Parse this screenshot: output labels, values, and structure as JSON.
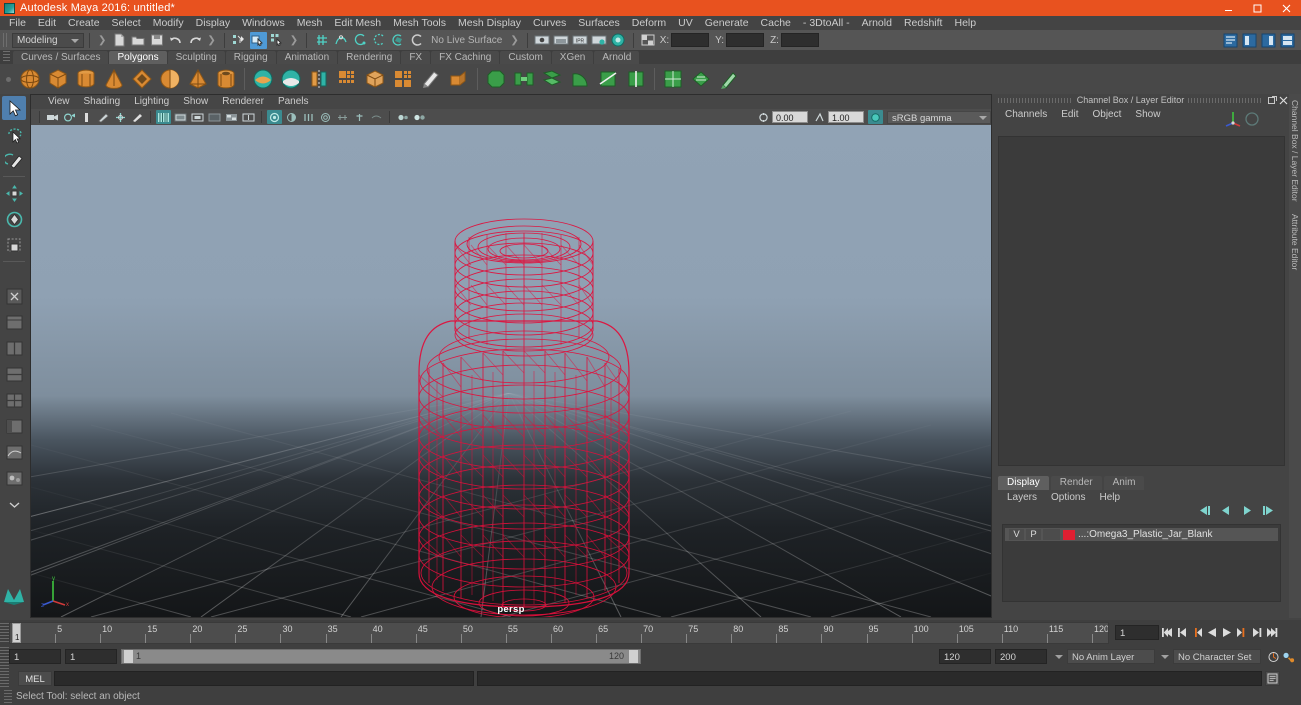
{
  "window": {
    "title": "Autodesk Maya 2016: untitled*",
    "app_icon": "maya-logo-icon",
    "titlebar_color": "#e8521f",
    "controls": {
      "minimize": "minimize-icon",
      "maximize": "maximize-icon",
      "close": "close-icon"
    }
  },
  "menubar": {
    "items": [
      "File",
      "Edit",
      "Create",
      "Select",
      "Modify",
      "Display",
      "Windows",
      "Mesh",
      "Edit Mesh",
      "Mesh Tools",
      "Mesh Display",
      "Curves",
      "Surfaces",
      "Deform",
      "UV",
      "Generate",
      "Cache",
      "- 3DtoAll -",
      "Arnold",
      "Redshift",
      "Help"
    ]
  },
  "statusline": {
    "mode": "Modeling",
    "live_surface": "No Live Surface",
    "coords": {
      "x_label": "X:",
      "x_value": "",
      "y_label": "Y:",
      "y_value": "",
      "z_label": "Z:",
      "z_value": ""
    },
    "file_icons": [
      "new-scene-icon",
      "open-scene-icon",
      "save-scene-icon",
      "undo-icon",
      "redo-icon"
    ],
    "select_mode_icons": [
      "select-by-hierarchy-icon",
      "select-by-object-type-icon",
      "select-by-component-type-icon"
    ],
    "snap_icons": [
      "snap-to-grid-icon",
      "snap-to-curve-icon",
      "snap-to-point-icon",
      "snap-to-projected-center-icon",
      "snap-to-view-plane-icon",
      "make-live-icon"
    ],
    "render_icons": [
      "render-current-frame-icon",
      "ipr-render-icon",
      "render-settings-icon",
      "hypershade-icon",
      "render-view-icon"
    ],
    "editor_icons": [
      "open-attribute-editor-icon",
      "open-tool-settings-icon",
      "open-channel-box-icon"
    ]
  },
  "shelf": {
    "tabs": [
      "Curves / Surfaces",
      "Polygons",
      "Sculpting",
      "Rigging",
      "Animation",
      "Rendering",
      "FX",
      "FX Caching",
      "Custom",
      "XGen",
      "Arnold"
    ],
    "active_tab": "Polygons",
    "icons": [
      "poly-sphere-icon",
      "poly-cube-icon",
      "poly-cylinder-icon",
      "poly-cone-icon",
      "poly-torus-icon",
      "poly-plane-icon",
      "poly-pyramid-icon",
      "poly-pipe-icon",
      "combine-icon",
      "separate-icon",
      "mirror-geometry-icon",
      "smooth-icon",
      "boolean-icon",
      "quadrangulate-icon",
      "edit-mesh-icon",
      "extrude-icon",
      "bevel-icon",
      "bridge-icon",
      "append-polygon-icon",
      "wedge-icon",
      "multi-cut-icon",
      "insert-edge-loop-icon",
      "offset-edge-loop-icon",
      "sculpt-geometry-icon",
      "uv-editor-icon",
      "planar-mapping-icon"
    ]
  },
  "toolbox": {
    "tools": [
      {
        "name": "select-tool-icon",
        "active": true
      },
      {
        "name": "lasso-select-tool-icon",
        "active": false
      },
      {
        "name": "paint-select-tool-icon",
        "active": false
      },
      {
        "name": "move-tool-icon",
        "active": false
      },
      {
        "name": "rotate-tool-icon",
        "active": false
      },
      {
        "name": "scale-tool-icon",
        "active": false
      }
    ],
    "layout_icons": [
      "last-tool-icon",
      "layout-single-icon",
      "layout-two-panes-side-icon",
      "layout-two-panes-stacked-icon",
      "layout-four-panes-icon",
      "layout-persp-outliner-icon",
      "layout-persp-graph-icon",
      "layout-hypershade-icon"
    ]
  },
  "viewport": {
    "menus": [
      "View",
      "Shading",
      "Lighting",
      "Show",
      "Renderer",
      "Panels"
    ],
    "camera_label": "persp",
    "exposure_value": "0.00",
    "gamma_value": "1.00",
    "color_management": "sRGB gamma",
    "toolbar_icons": [
      "select-camera-icon",
      "camera-attributes-icon",
      "bookmark-icon",
      "image-plane-icon",
      "two-dimensional-pan-zoom-icon",
      "grease-pencil-icon",
      "wireframe-on-shaded-icon",
      "smooth-shade-all-icon",
      "shaded-wireframe-icon",
      "use-default-material-icon",
      "textured-mode-icon",
      "use-all-lights-icon",
      "shadows-icon",
      "screen-space-ambient-occlusion-icon",
      "motion-blur-icon",
      "multisample-anti-aliasing-icon",
      "depth-of-field-icon",
      "isolate-select-icon",
      "xray-mode-icon",
      "xray-joints-icon"
    ],
    "object": {
      "type": "wireframe-mesh",
      "name": "Omega3_Plastic_Jar_Blank",
      "wireframe_color": "#e0103c",
      "selected": true
    },
    "background_top_color": "#91a3b5",
    "background_bottom_color": "#141618",
    "grid_visible": true,
    "axis_gizmo": {
      "x_color": "#d13a3a",
      "y_color": "#3ec43e",
      "z_color": "#3a5ad1",
      "labels": [
        "x",
        "y",
        "z"
      ]
    }
  },
  "channel_box": {
    "panel_title": "Channel Box / Layer Editor",
    "menus": [
      "Channels",
      "Edit",
      "Object",
      "Show"
    ],
    "content": "",
    "undock_icon": "undock-icon",
    "close_icon": "close-panel-icon"
  },
  "layer_editor": {
    "tabs": [
      "Display",
      "Render",
      "Anim"
    ],
    "active_tab": "Display",
    "menus": [
      "Layers",
      "Options",
      "Help"
    ],
    "buttons": [
      "layer-first-icon",
      "layer-prev-icon",
      "layer-next-icon",
      "layer-last-icon"
    ],
    "layers": [
      {
        "visibility": "V",
        "playback": "P",
        "color": "#e01f32",
        "name": "...:Omega3_Plastic_Jar_Blank"
      }
    ]
  },
  "right_vertical_tabs": [
    "Channel Box / Layer Editor",
    "Attribute Editor"
  ],
  "time_slider": {
    "current_frame": "1",
    "playback_field": "1",
    "ticks": [
      {
        "label": "5",
        "frame": 5
      },
      {
        "label": "10",
        "frame": 10
      },
      {
        "label": "15",
        "frame": 15
      },
      {
        "label": "20",
        "frame": 20
      },
      {
        "label": "25",
        "frame": 25
      },
      {
        "label": "30",
        "frame": 30
      },
      {
        "label": "35",
        "frame": 35
      },
      {
        "label": "40",
        "frame": 40
      },
      {
        "label": "45",
        "frame": 45
      },
      {
        "label": "50",
        "frame": 50
      },
      {
        "label": "55",
        "frame": 55
      },
      {
        "label": "60",
        "frame": 60
      },
      {
        "label": "65",
        "frame": 65
      },
      {
        "label": "70",
        "frame": 70
      },
      {
        "label": "75",
        "frame": 75
      },
      {
        "label": "80",
        "frame": 80
      },
      {
        "label": "85",
        "frame": 85
      },
      {
        "label": "90",
        "frame": 90
      },
      {
        "label": "95",
        "frame": 95
      },
      {
        "label": "100",
        "frame": 100
      },
      {
        "label": "105",
        "frame": 105
      },
      {
        "label": "110",
        "frame": 110
      },
      {
        "label": "115",
        "frame": 115
      },
      {
        "label": "120",
        "frame": 120
      }
    ],
    "playback_buttons": [
      "go-to-start-icon",
      "step-back-frame-icon",
      "step-back-key-icon",
      "play-backwards-icon",
      "play-forwards-icon",
      "step-forward-key-icon",
      "step-forward-frame-icon",
      "go-to-end-icon"
    ]
  },
  "range_slider": {
    "start_field": "1",
    "range_start_field": "1",
    "range_bar_start": "1",
    "range_bar_end": "120",
    "range_end_field": "120",
    "end_field": "200",
    "anim_layer": "No Anim Layer",
    "character_set": "No Character Set",
    "auto_key_icon": "auto-keyframe-icon",
    "anim_prefs_icon": "animation-preferences-icon"
  },
  "command_line": {
    "language_label": "MEL",
    "input_value": "",
    "output_value": "",
    "script_editor_icon": "script-editor-icon"
  },
  "help_line": {
    "text": "Select Tool: select an object"
  }
}
